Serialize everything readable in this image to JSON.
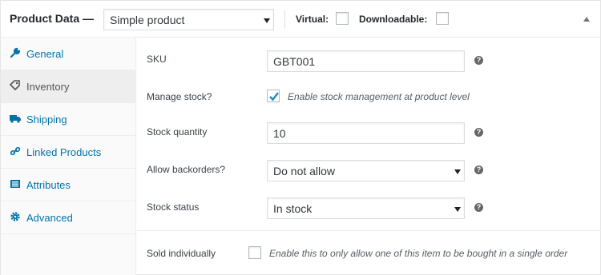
{
  "header": {
    "title": "Product Data",
    "dash": "—",
    "product_type": "Simple product",
    "virtual_label": "Virtual:",
    "virtual_checked": false,
    "downloadable_label": "Downloadable:",
    "downloadable_checked": false
  },
  "sidebar": {
    "items": [
      {
        "label": "General",
        "icon": "wrench-icon",
        "active": false
      },
      {
        "label": "Inventory",
        "icon": "tag-icon",
        "active": true
      },
      {
        "label": "Shipping",
        "icon": "truck-icon",
        "active": false
      },
      {
        "label": "Linked Products",
        "icon": "link-icon",
        "active": false
      },
      {
        "label": "Attributes",
        "icon": "list-icon",
        "active": false
      },
      {
        "label": "Advanced",
        "icon": "gear-icon",
        "active": false
      }
    ]
  },
  "form": {
    "sku_label": "SKU",
    "sku_value": "GBT001",
    "manage_stock_label": "Manage stock?",
    "manage_stock_checked": true,
    "manage_stock_desc": "Enable stock management at product level",
    "stock_qty_label": "Stock quantity",
    "stock_qty_value": "10",
    "backorders_label": "Allow backorders?",
    "backorders_value": "Do not allow",
    "stock_status_label": "Stock status",
    "stock_status_value": "In stock",
    "sold_individually_label": "Sold individually",
    "sold_individually_checked": false,
    "sold_individually_desc": "Enable this to only allow one of this item to be bought in a single order",
    "help_glyph": "?"
  },
  "colors": {
    "accent": "#0073aa",
    "checkmark": "#1e8cbe"
  }
}
